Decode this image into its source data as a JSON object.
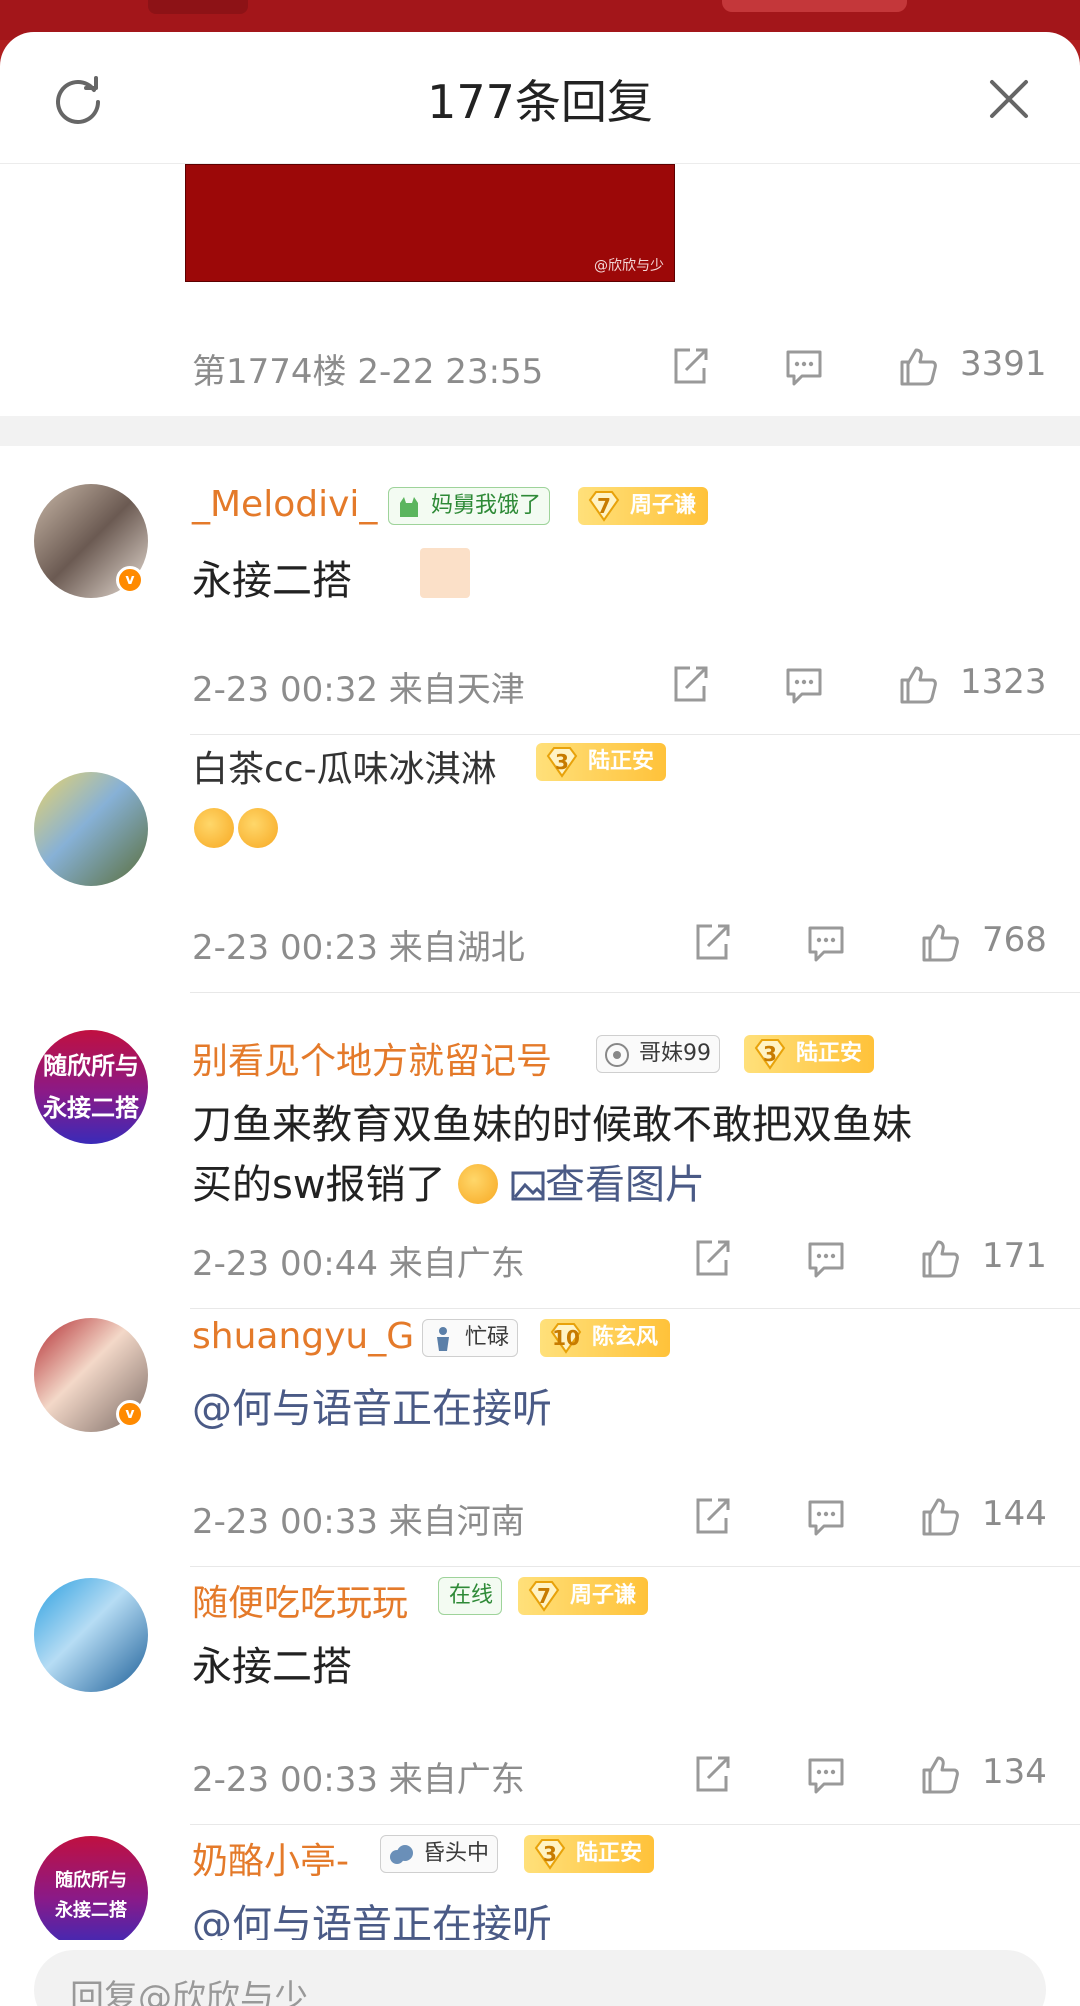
{
  "header": {
    "title": "177条回复"
  },
  "image_watermark": "@欣欣与少",
  "top_comment": {
    "floor_time": "第1774楼 2-22 23:55",
    "likes": "3391"
  },
  "comments": [
    {
      "name": "_Melodivi_",
      "fan_badge": "妈舅我饿了",
      "level": "7",
      "level_name": "周子谦",
      "text": "永接二搭",
      "meta": "2-23 00:32  来自天津",
      "likes": "1323"
    },
    {
      "name": "白茶cc-瓜味冰淇淋",
      "level": "3",
      "level_name": "陆正安",
      "meta": "2-23 00:23  来自湖北",
      "likes": "768"
    },
    {
      "name": "别看见个地方就留记号",
      "avatar_text_1": "随欣所与",
      "avatar_text_2": "永接二搭",
      "fan_badge": "哥妹99",
      "level": "3",
      "level_name": "陆正安",
      "text_line1": "刀鱼来教育双鱼妹的时候敢不敢把双鱼妹",
      "text_line2": "买的sw报销了",
      "image_link": "查看图片",
      "meta": "2-23 00:44  来自广东",
      "likes": "171"
    },
    {
      "name": "shuangyu_G",
      "fan_badge": "忙碌",
      "level": "10",
      "level_name": "陈玄风",
      "text": "@何与语音正在接听",
      "meta": "2-23 00:33  来自河南",
      "likes": "144"
    },
    {
      "name": "随便吃吃玩玩",
      "fan_badge": "在线",
      "level": "7",
      "level_name": "周子谦",
      "text": "永接二搭",
      "meta": "2-23 00:33  来自广东",
      "likes": "134"
    },
    {
      "name": "奶酪小亭-",
      "avatar_text_1": "随欣所与",
      "avatar_text_2": "永接二搭",
      "fan_badge": "昏头中",
      "level": "3",
      "level_name": "陆正安",
      "text": "@何与语音正在接听"
    }
  ],
  "reply_bar": {
    "placeholder": "回复@欣欣与少"
  },
  "colors": {
    "name_orange": "#e47a2a",
    "link_blue": "#4a5a86",
    "meta_gray": "#8c8c8c"
  }
}
